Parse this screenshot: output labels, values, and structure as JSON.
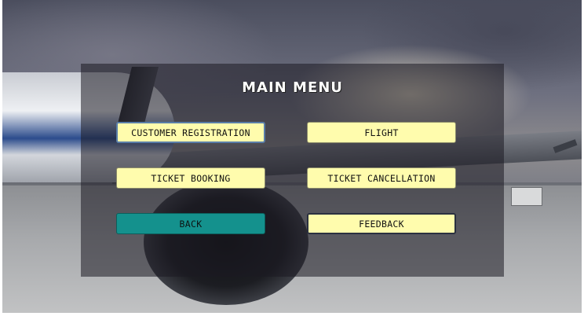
{
  "menu": {
    "title": "MAIN MENU",
    "buttons": {
      "customer_registration": "CUSTOMER REGISTRATION",
      "flight": "FLIGHT",
      "ticket_booking": "TICKET BOOKING",
      "ticket_cancellation": "TICKET CANCELLATION",
      "back": "BACK",
      "feedback": "FEEDBACK"
    }
  },
  "colors": {
    "button_bg": "#fffcad",
    "back_button_bg": "#14918d",
    "panel_overlay": "rgba(28,26,34,0.55)"
  }
}
